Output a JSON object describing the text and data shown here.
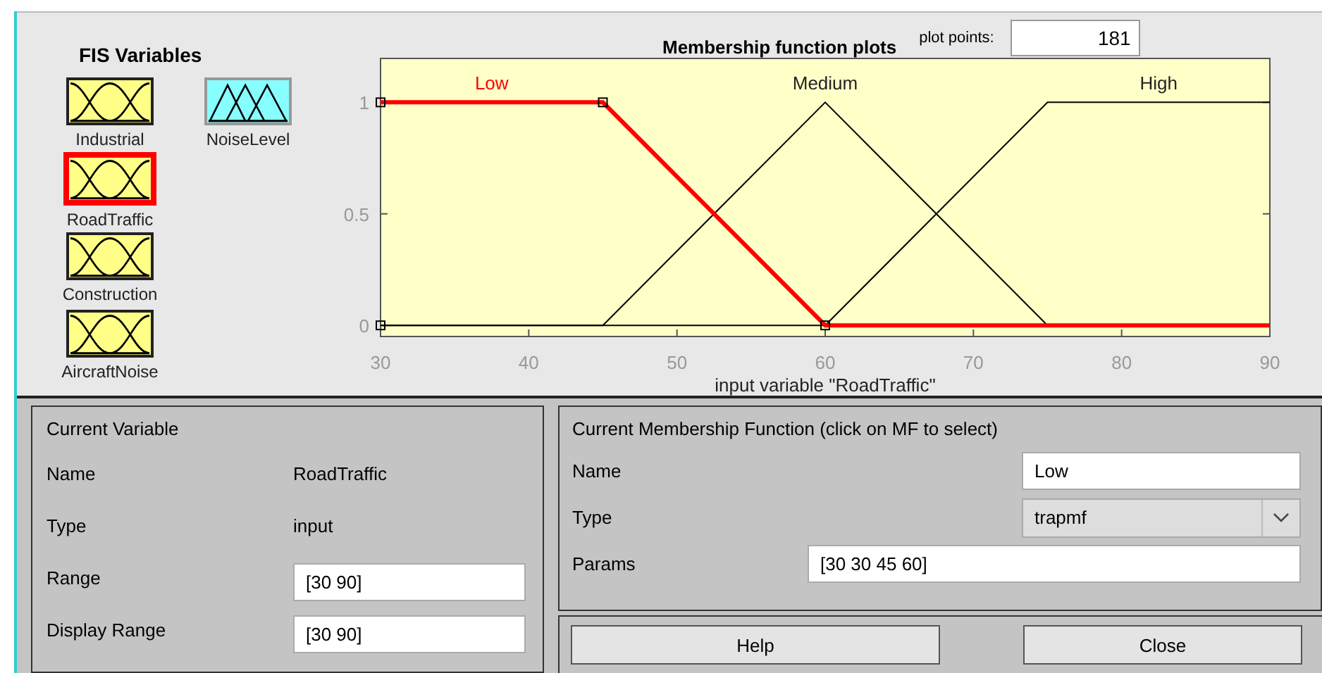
{
  "fis_variables": {
    "title": "FIS Variables",
    "variables": [
      {
        "name": "Industrial",
        "kind": "input",
        "selected": false
      },
      {
        "name": "RoadTraffic",
        "kind": "input",
        "selected": true
      },
      {
        "name": "Construction",
        "kind": "input",
        "selected": false
      },
      {
        "name": "AircraftNoise",
        "kind": "input",
        "selected": false
      },
      {
        "name": "NoiseLevel",
        "kind": "output",
        "selected": false
      }
    ]
  },
  "plot": {
    "plot_points_label": "plot points:",
    "plot_points": "181",
    "chart_data": {
      "type": "line",
      "title": "Membership function plots",
      "xlabel": "input variable \"RoadTraffic\"",
      "x": [
        30,
        45,
        60,
        75,
        90
      ],
      "xlim": [
        30,
        90
      ],
      "ylim": [
        -0.05,
        1.2
      ],
      "xticks": [
        30,
        40,
        50,
        60,
        70,
        80,
        90
      ],
      "yticks": [
        0,
        0.5,
        1
      ],
      "series": [
        {
          "name": "Low",
          "color": "#ff0000",
          "values": [
            1,
            1,
            0,
            0,
            0
          ]
        },
        {
          "name": "Medium",
          "color": "#000000",
          "values": [
            0,
            0,
            1,
            0,
            0
          ]
        },
        {
          "name": "High",
          "color": "#000000",
          "values": [
            0,
            0,
            0,
            1,
            1
          ]
        }
      ]
    },
    "membership_functions": [
      {
        "selected": true
      },
      {
        "selected": false
      },
      {
        "selected": false
      }
    ]
  },
  "current_variable": {
    "title": "Current Variable",
    "name_label": "Name",
    "name": "RoadTraffic",
    "type_label": "Type",
    "type": "input",
    "range_label": "Range",
    "range": "[30 90]",
    "display_range_label": "Display Range",
    "display_range": "[30 90]"
  },
  "current_mf": {
    "title": "Current Membership Function (click on MF to select)",
    "name_label": "Name",
    "name": "Low",
    "type_label": "Type",
    "type": "trapmf",
    "params_label": "Params",
    "params": "[30 30 45 60]"
  },
  "buttons": [
    "Help",
    "Close"
  ]
}
